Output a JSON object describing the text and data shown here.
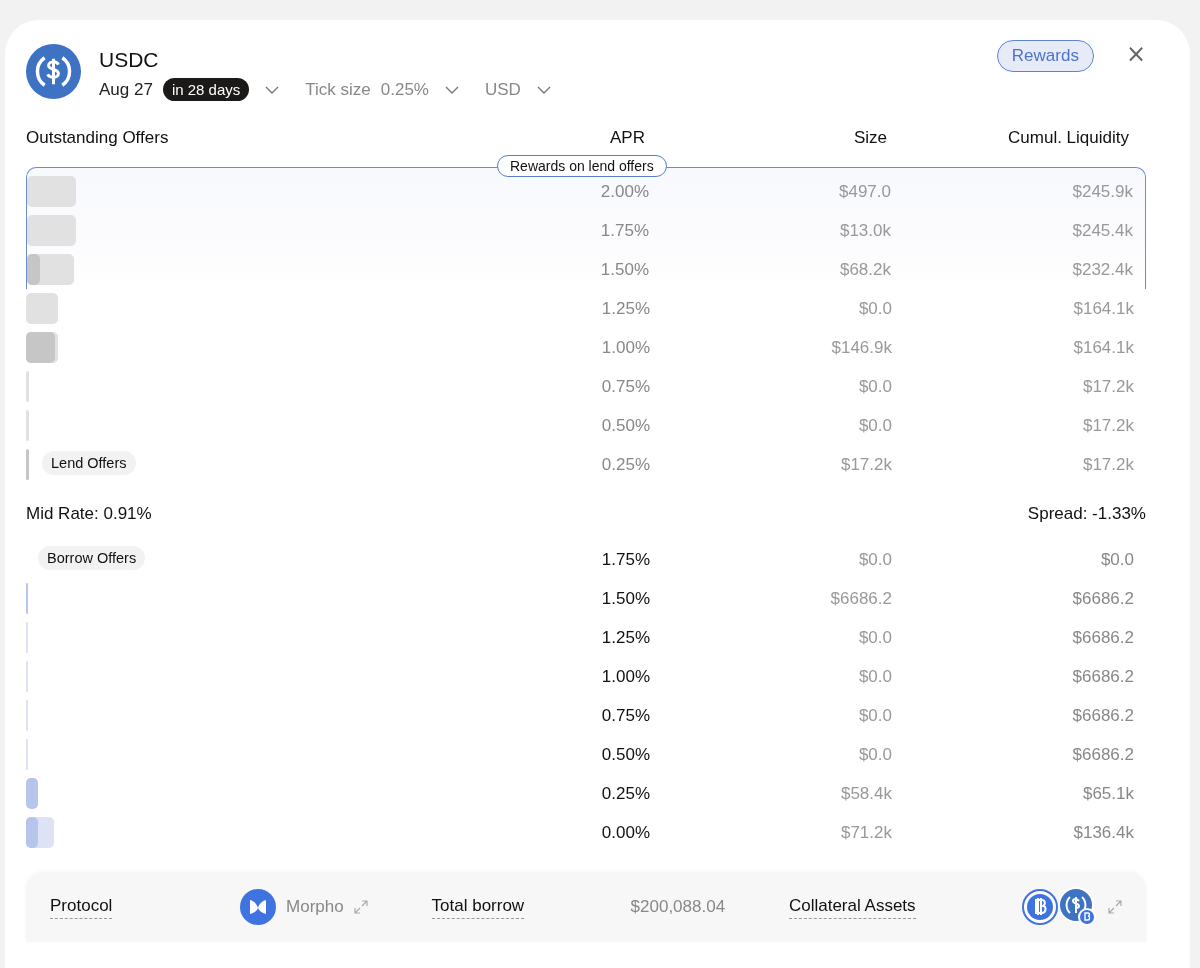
{
  "asset": {
    "name": "USDC",
    "date": "Aug 27",
    "countdown": "in 28 days",
    "tick_label": "Tick size",
    "tick_value": "0.25%",
    "currency": "USD"
  },
  "rewards_button": "Rewards",
  "close": "×",
  "columns": [
    "Outstanding Offers",
    "APR",
    "Size",
    "Cumul. Liquidity"
  ],
  "rewards_badge": "Rewards on lend offers",
  "lend": {
    "label": "Lend Offers",
    "rows": [
      {
        "apr": "2.00%",
        "size": "$497.0",
        "cumul": "$245.9k",
        "rewards": true,
        "total": {
          "level": 0.044
        },
        "own": {
          "level": 0
        }
      },
      {
        "apr": "1.75%",
        "size": "$13.0k",
        "cumul": "$245.4k",
        "rewards": true,
        "total": {
          "level": 0.044
        },
        "own": {
          "level": 0
        }
      },
      {
        "apr": "1.50%",
        "size": "$68.2k",
        "cumul": "$232.4k",
        "rewards": true,
        "total": {
          "level": 0.042
        },
        "own": {
          "level": 0.012
        }
      },
      {
        "apr": "1.25%",
        "size": "$0.0",
        "cumul": "$164.1k",
        "rewards": false,
        "total": {
          "level": 0.029
        },
        "own": {
          "level": 0
        }
      },
      {
        "apr": "1.00%",
        "size": "$146.9k",
        "cumul": "$164.1k",
        "rewards": false,
        "total": {
          "level": 0.029
        },
        "own": {
          "level": 0.026
        }
      },
      {
        "apr": "0.75%",
        "size": "$0.0",
        "cumul": "$17.2k",
        "rewards": false,
        "total": {
          "level": 0.003
        },
        "own": {
          "level": 0
        }
      },
      {
        "apr": "0.50%",
        "size": "$0.0",
        "cumul": "$17.2k",
        "rewards": false,
        "total": {
          "level": 0.003
        },
        "own": {
          "level": 0
        }
      },
      {
        "apr": "0.25%",
        "size": "$17.2k",
        "cumul": "$17.2k",
        "rewards": false,
        "total": {
          "level": 0.003
        },
        "own": {
          "level": 0.003
        }
      }
    ]
  },
  "mid_rate": "Mid Rate: 0.91%",
  "spread": "Spread: -1.33%",
  "borrow": {
    "label": "Borrow Offers",
    "rows": [
      {
        "apr": "1.75%",
        "size": "$0.0",
        "cumul": "$0.0"
      },
      {
        "apr": "1.50%",
        "size": "$6686.2",
        "cumul": "$6686.2",
        "total": {
          "level": 0.002
        },
        "own": {
          "level": 0.002
        }
      },
      {
        "apr": "1.25%",
        "size": "$0.0",
        "cumul": "$6686.2",
        "total": {
          "level": 0.002
        },
        "own": {
          "level": 0
        }
      },
      {
        "apr": "1.00%",
        "size": "$0.0",
        "cumul": "$6686.2",
        "total": {
          "level": 0.002
        },
        "own": {
          "level": 0
        }
      },
      {
        "apr": "0.75%",
        "size": "$0.0",
        "cumul": "$6686.2",
        "total": {
          "level": 0.002
        },
        "own": {
          "level": 0
        }
      },
      {
        "apr": "0.50%",
        "size": "$0.0",
        "cumul": "$6686.2",
        "total": {
          "level": 0.002
        },
        "own": {
          "level": 0
        }
      },
      {
        "apr": "0.25%",
        "size": "$58.4k",
        "cumul": "$65.1k",
        "total": {
          "level": 0.011
        },
        "own": {
          "level": 0.011
        }
      },
      {
        "apr": "0.00%",
        "size": "$71.2k",
        "cumul": "$136.4k",
        "total": {
          "level": 0.025
        },
        "own": {
          "level": 0.011
        }
      }
    ]
  },
  "footer": {
    "protocol_label": "Protocol",
    "protocol": "Morpho",
    "borrow_label": "Total borrow",
    "borrow_value": "$200,088.04",
    "collateral_label": "Collateral Assets"
  }
}
